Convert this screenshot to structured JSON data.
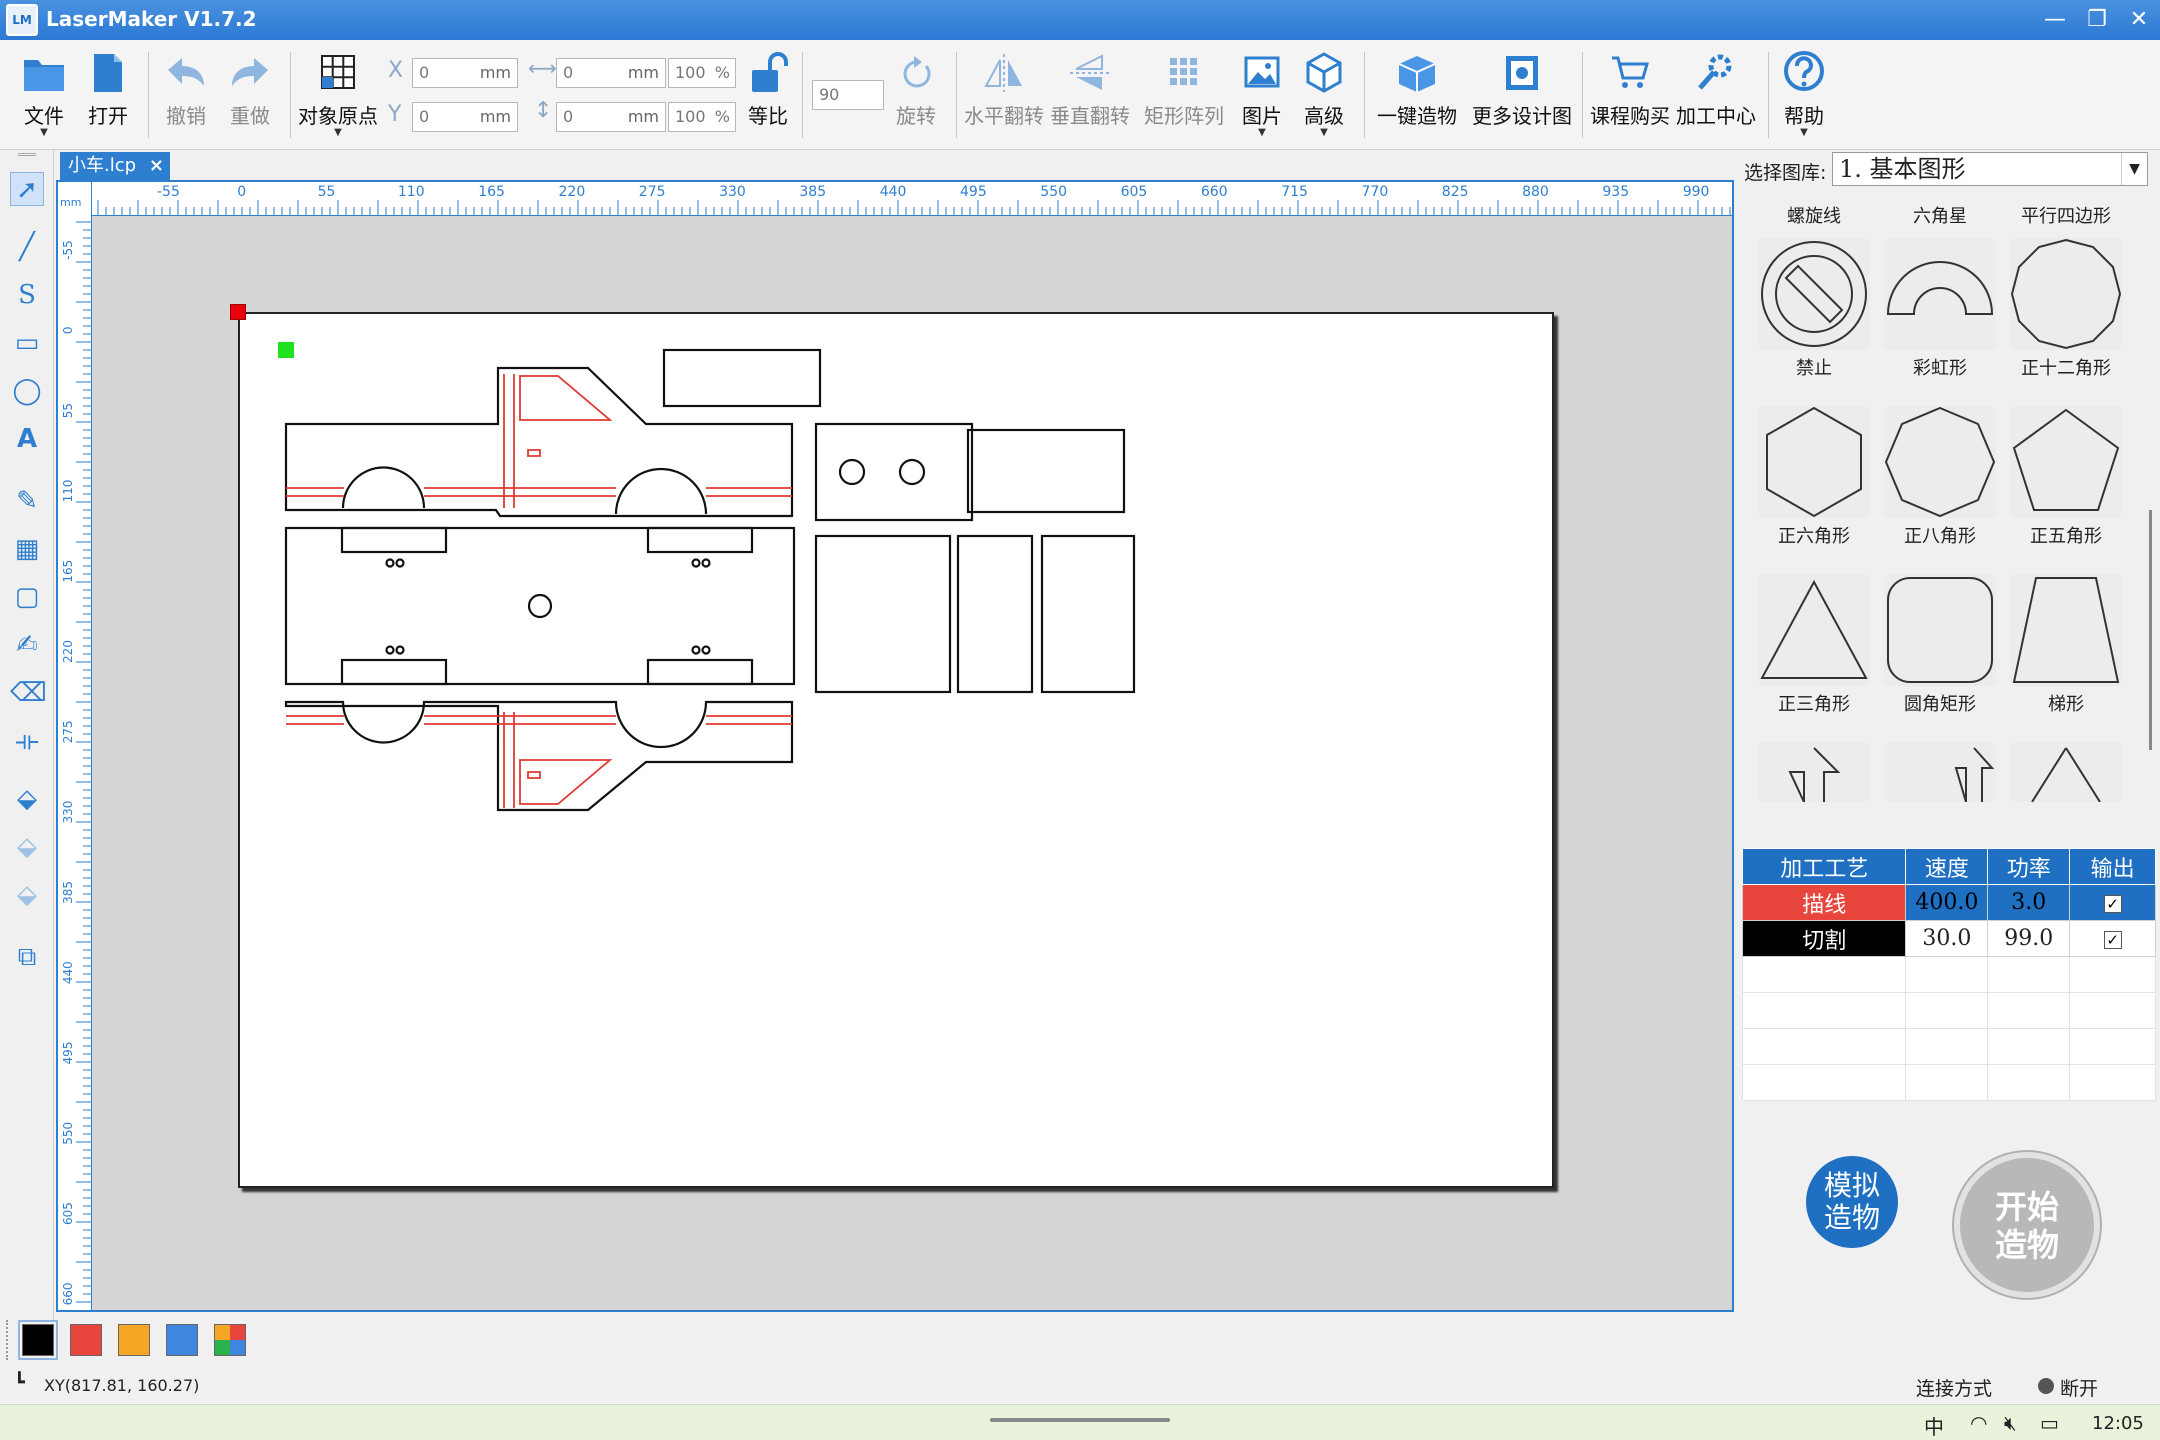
{
  "window": {
    "title": "LaserMaker V1.7.2",
    "icon": "LM"
  },
  "toolbar": {
    "file": "文件",
    "open": "打开",
    "undo": "撤销",
    "redo": "重做",
    "origin": "对象原点",
    "x_label": "X",
    "y_label": "Y",
    "x_value": "0",
    "y_value": "0",
    "unit": "mm",
    "w_value": "0",
    "h_value": "0",
    "w_pct": "100",
    "h_pct": "100",
    "pct": "%",
    "ratio": "等比",
    "rotate_value": "90",
    "rotate": "旋转",
    "hflip": "水平翻转",
    "vflip": "垂直翻转",
    "array": "矩形阵列",
    "image": "图片",
    "advanced": "高级",
    "oneclick": "一键造物",
    "more": "更多设计图",
    "course": "课程购买",
    "center": "加工中心",
    "help": "帮助"
  },
  "tab": {
    "name": "小车.lcp",
    "close": "×"
  },
  "ruler": {
    "unit": "mm",
    "top_ticks": [
      "-55",
      "0",
      "55",
      "110",
      "165",
      "220",
      "275",
      "330",
      "385",
      "440",
      "495",
      "550",
      "605",
      "660",
      "715",
      "770",
      "825",
      "880",
      "935",
      "990"
    ],
    "left_ticks": [
      "-55",
      "0",
      "55",
      "110",
      "165",
      "220",
      "275",
      "330",
      "385",
      "440",
      "495",
      "550",
      "605",
      "660"
    ]
  },
  "library": {
    "label": "选择图库:",
    "selected": "1. 基本图形",
    "items": [
      {
        "name": "螺旋线"
      },
      {
        "name": "六角星"
      },
      {
        "name": "平行四边形"
      },
      {
        "name": "禁止"
      },
      {
        "name": "彩虹形"
      },
      {
        "name": "正十二角形"
      },
      {
        "name": "正六角形"
      },
      {
        "name": "正八角形"
      },
      {
        "name": "正五角形"
      },
      {
        "name": "正三角形"
      },
      {
        "name": "圆角矩形"
      },
      {
        "name": "梯形"
      }
    ]
  },
  "process": {
    "headers": [
      "加工工艺",
      "速度",
      "功率",
      "输出"
    ],
    "rows": [
      {
        "name": "描线",
        "speed": "400.0",
        "power": "3.0",
        "color": "#e8453c",
        "checked": "✓"
      },
      {
        "name": "切割",
        "speed": "30.0",
        "power": "99.0",
        "color": "#000000",
        "checked": "✓"
      }
    ]
  },
  "actions": {
    "simulate_l1": "模拟",
    "simulate_l2": "造物",
    "start_l1": "开始",
    "start_l2": "造物"
  },
  "swatches": [
    "#000000",
    "#e8453c",
    "#f5a623",
    "#3f86e0"
  ],
  "status": {
    "xy": "XY(817.81, 160.27)",
    "conn_label": "连接方式",
    "conn_state": "断开"
  },
  "taskbar": {
    "ime": "中",
    "time": "12:05"
  }
}
